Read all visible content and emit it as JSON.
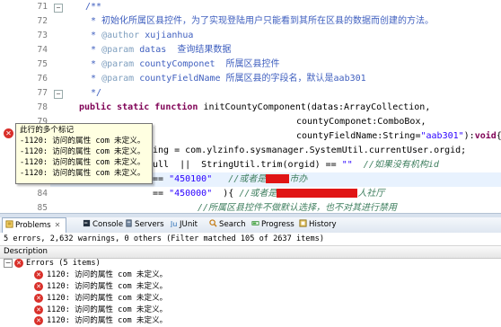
{
  "editor": {
    "line_numbers": [
      "71",
      "72",
      "73",
      "74",
      "75",
      "76",
      "77",
      "78",
      "79",
      "80",
      "81",
      "82",
      "83",
      "84",
      "85",
      "86",
      "87"
    ],
    "lines": {
      "l71": "/**",
      "l72": " * 初始化所属区县控件，为了实现登陆用户只能看到其所在区县的数据而创建的方法。",
      "l73_tag": "@author",
      "l73_rest": " xujianhua",
      "l74_tag": "@param",
      "l74_rest": " datas  查询结果数据",
      "l75_tag": "@param",
      "l75_rest": " countyComponet  所属区县控件",
      "l76_tag": "@param",
      "l76_rest": " countyFieldName 所属区县的字段名，默认是aab301",
      "l77": " */",
      "l78_kw1": "public static function",
      "l78_rest": " initCountyComponent(datas:ArrayCollection,",
      "l79": "countyComponet:ComboBox,",
      "l80_a": "countyFieldName:String=",
      "l80_str": "\"aab301\"",
      "l80_b": "):",
      "l80_kw": "void",
      "l80_c": "{",
      "l81": "ing = com.ylzinfo.sysmanager.SystemUtil.currentUser.orgid;",
      "l82_a": "ull  ||  StringUtil.trim(orgid) == ",
      "l82_str": "\"\"",
      "l82_cm": "  //如果没有机构id",
      "l83_a": "== ",
      "l83_str": "\"450100\"",
      "l83_cm": "   //或者是",
      "l83_cm2": "市办",
      "l84_a": "== ",
      "l84_str": "\"450000\"",
      "l84_b": "  ){ ",
      "l84_cm": "//或者是",
      "l84_cm2": "人社厅",
      "l85_cm": "//所属区县控件不做默认选择，也不对其进行禁用",
      "l86": "}",
      "l87": ""
    },
    "tooltip": {
      "title": "此行的多个标记",
      "items": [
        "-1120: 访问的属性 com 未定义。",
        "-1120: 访问的属性 com 未定义。",
        "-1120: 访问的属性 com 未定义。",
        "-1120: 访问的属性 com 未定义。"
      ]
    }
  },
  "tabs": [
    {
      "label": "Problems",
      "icon": "problems-icon",
      "active": true
    },
    {
      "label": "Console",
      "icon": "console-icon"
    },
    {
      "label": "Servers",
      "icon": "servers-icon"
    },
    {
      "label": "JUnit",
      "icon": "junit-icon"
    },
    {
      "label": "Search",
      "icon": "search-icon"
    },
    {
      "label": "Progress",
      "icon": "progress-icon"
    },
    {
      "label": "History",
      "icon": "history-icon"
    }
  ],
  "status": "5 errors, 2,632 warnings, 0 others (Filter matched 105 of 2637 items)",
  "table": {
    "column": "Description",
    "group": "Errors (5 items)",
    "errors": [
      "1120: 访问的属性 com 未定义。",
      "1120: 访问的属性 com 未定义。",
      "1120: 访问的属性 com 未定义。",
      "1120: 访问的属性 com 未定义。",
      "1120: 访问的属性 com 未定义。"
    ]
  },
  "colors": {
    "keyword": "#7f0055",
    "string": "#2a00ff",
    "doc_comment": "#3f5fbf",
    "comment": "#3f7f5f",
    "error": "#d9302a",
    "tooltip_bg": "#ffffe1"
  }
}
